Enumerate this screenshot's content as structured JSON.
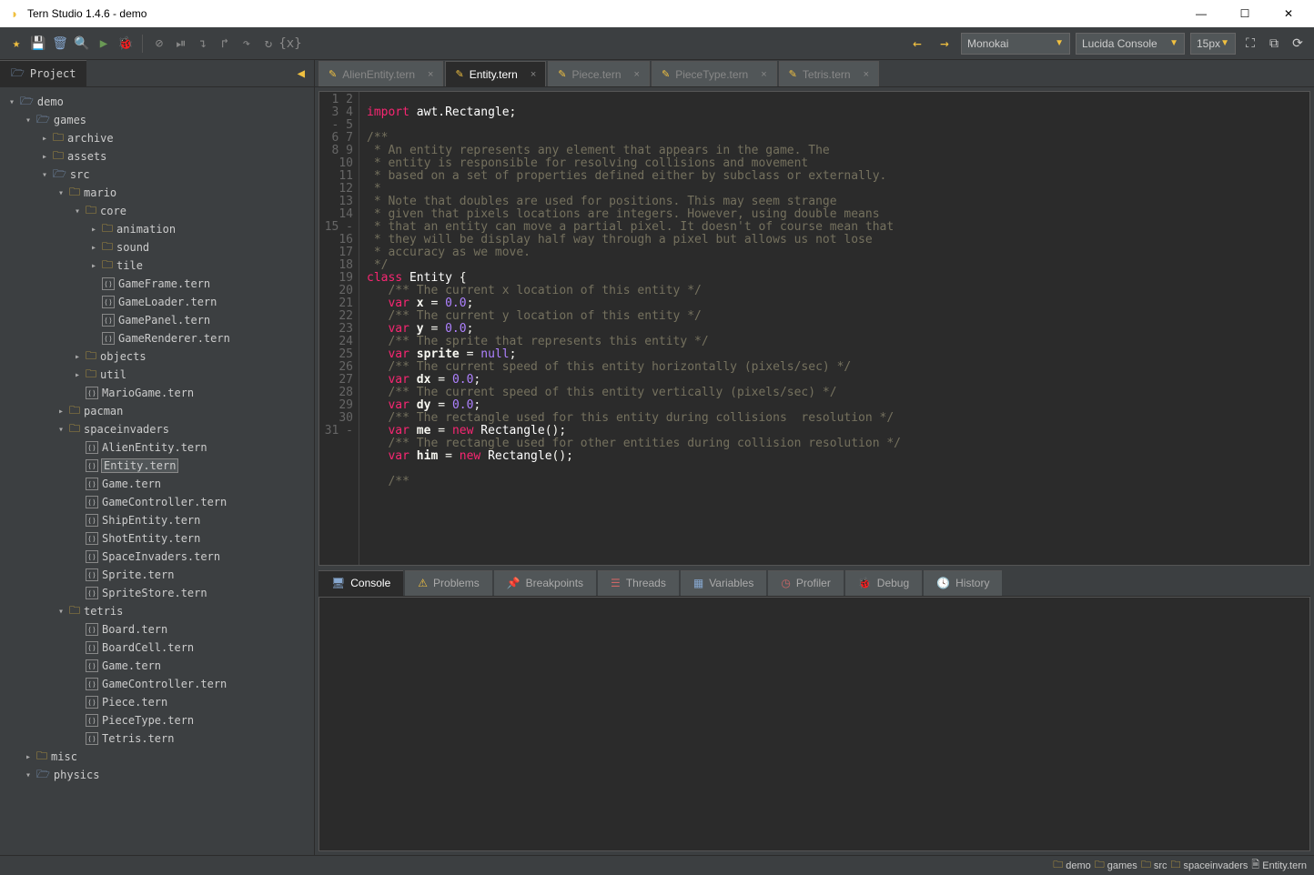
{
  "window": {
    "title": "Tern Studio 1.4.6 - demo"
  },
  "toolbar": {
    "nav_back": "←",
    "nav_fwd": "→",
    "theme": "Monokai",
    "font": "Lucida Console",
    "size": "15px"
  },
  "sidebar": {
    "tab": "Project",
    "chev": "◀"
  },
  "tree": [
    {
      "d": 0,
      "caret": "▾",
      "icon": "folder-open",
      "label": "demo"
    },
    {
      "d": 1,
      "caret": "▾",
      "icon": "folder-open",
      "label": "games"
    },
    {
      "d": 2,
      "caret": "▸",
      "icon": "folder",
      "label": "archive"
    },
    {
      "d": 2,
      "caret": "▸",
      "icon": "folder",
      "label": "assets"
    },
    {
      "d": 2,
      "caret": "▾",
      "icon": "folder-open",
      "label": "src"
    },
    {
      "d": 3,
      "caret": "▾",
      "icon": "folder",
      "label": "mario"
    },
    {
      "d": 4,
      "caret": "▾",
      "icon": "folder",
      "label": "core"
    },
    {
      "d": 5,
      "caret": "▸",
      "icon": "folder",
      "label": "animation"
    },
    {
      "d": 5,
      "caret": "▸",
      "icon": "folder",
      "label": "sound"
    },
    {
      "d": 5,
      "caret": "▸",
      "icon": "folder",
      "label": "tile"
    },
    {
      "d": 5,
      "caret": "",
      "icon": "file",
      "label": "GameFrame.tern"
    },
    {
      "d": 5,
      "caret": "",
      "icon": "file",
      "label": "GameLoader.tern"
    },
    {
      "d": 5,
      "caret": "",
      "icon": "file",
      "label": "GamePanel.tern"
    },
    {
      "d": 5,
      "caret": "",
      "icon": "file",
      "label": "GameRenderer.tern"
    },
    {
      "d": 4,
      "caret": "▸",
      "icon": "folder",
      "label": "objects"
    },
    {
      "d": 4,
      "caret": "▸",
      "icon": "folder",
      "label": "util"
    },
    {
      "d": 4,
      "caret": "",
      "icon": "file",
      "label": "MarioGame.tern"
    },
    {
      "d": 3,
      "caret": "▸",
      "icon": "folder",
      "label": "pacman"
    },
    {
      "d": 3,
      "caret": "▾",
      "icon": "folder",
      "label": "spaceinvaders"
    },
    {
      "d": 4,
      "caret": "",
      "icon": "file",
      "label": "AlienEntity.tern"
    },
    {
      "d": 4,
      "caret": "",
      "icon": "file",
      "label": "Entity.tern",
      "selected": true
    },
    {
      "d": 4,
      "caret": "",
      "icon": "file",
      "label": "Game.tern"
    },
    {
      "d": 4,
      "caret": "",
      "icon": "file",
      "label": "GameController.tern"
    },
    {
      "d": 4,
      "caret": "",
      "icon": "file",
      "label": "ShipEntity.tern"
    },
    {
      "d": 4,
      "caret": "",
      "icon": "file",
      "label": "ShotEntity.tern"
    },
    {
      "d": 4,
      "caret": "",
      "icon": "file",
      "label": "SpaceInvaders.tern"
    },
    {
      "d": 4,
      "caret": "",
      "icon": "file",
      "label": "Sprite.tern"
    },
    {
      "d": 4,
      "caret": "",
      "icon": "file",
      "label": "SpriteStore.tern"
    },
    {
      "d": 3,
      "caret": "▾",
      "icon": "folder",
      "label": "tetris"
    },
    {
      "d": 4,
      "caret": "",
      "icon": "file",
      "label": "Board.tern"
    },
    {
      "d": 4,
      "caret": "",
      "icon": "file",
      "label": "BoardCell.tern"
    },
    {
      "d": 4,
      "caret": "",
      "icon": "file",
      "label": "Game.tern"
    },
    {
      "d": 4,
      "caret": "",
      "icon": "file",
      "label": "GameController.tern"
    },
    {
      "d": 4,
      "caret": "",
      "icon": "file",
      "label": "Piece.tern"
    },
    {
      "d": 4,
      "caret": "",
      "icon": "file",
      "label": "PieceType.tern"
    },
    {
      "d": 4,
      "caret": "",
      "icon": "file",
      "label": "Tetris.tern"
    },
    {
      "d": 1,
      "caret": "▸",
      "icon": "folder",
      "label": "misc"
    },
    {
      "d": 1,
      "caret": "▾",
      "icon": "folder-open",
      "label": "physics"
    }
  ],
  "tabs": [
    {
      "label": "AlienEntity.tern",
      "active": false
    },
    {
      "label": "Entity.tern",
      "active": true
    },
    {
      "label": "Piece.tern",
      "active": false
    },
    {
      "label": "PieceType.tern",
      "active": false
    },
    {
      "label": "Tetris.tern",
      "active": false
    }
  ],
  "code_lines": 31,
  "panels": [
    {
      "icon": "🖥",
      "label": "Console",
      "active": true,
      "color": "#87a8d0"
    },
    {
      "icon": "⚠",
      "label": "Problems",
      "active": false,
      "color": "#f0c040"
    },
    {
      "icon": "📌",
      "label": "Breakpoints",
      "active": false,
      "color": "#6a9955"
    },
    {
      "icon": "☰",
      "label": "Threads",
      "active": false,
      "color": "#cc6666"
    },
    {
      "icon": "▦",
      "label": "Variables",
      "active": false,
      "color": "#87a8d0"
    },
    {
      "icon": "◷",
      "label": "Profiler",
      "active": false,
      "color": "#cc6666"
    },
    {
      "icon": "🐞",
      "label": "Debug",
      "active": false,
      "color": "#6a9955"
    },
    {
      "icon": "🕓",
      "label": "History",
      "active": false,
      "color": "#c0a060"
    }
  ],
  "breadcrumb": [
    {
      "icon": "folder",
      "label": "demo"
    },
    {
      "icon": "folder",
      "label": "games"
    },
    {
      "icon": "folder",
      "label": "src"
    },
    {
      "icon": "folder",
      "label": "spaceinvaders"
    },
    {
      "icon": "file",
      "label": "Entity.tern"
    }
  ]
}
